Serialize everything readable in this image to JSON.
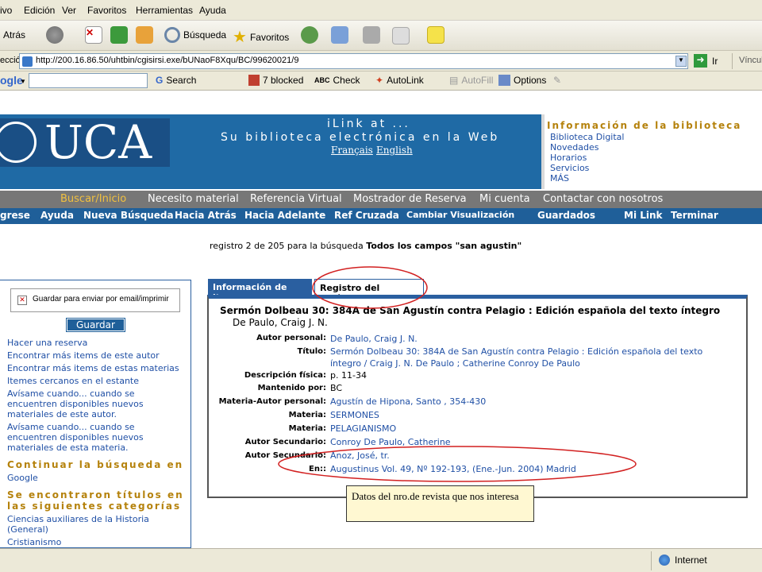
{
  "menubar": {
    "items": [
      "ivo",
      "Edición",
      "Ver",
      "Favoritos",
      "Herramientas",
      "Ayuda"
    ]
  },
  "toolbar": {
    "back": "Atrás",
    "search": "Búsqueda",
    "favorites": "Favoritos"
  },
  "address": {
    "label": "ección",
    "url": "http://200.16.86.50/uhtbin/cgisirsi.exe/bUNaoF8Xqu/BC/99620021/9",
    "go": "Ir",
    "links": "Víncul"
  },
  "googlebar": {
    "brand": "ogle",
    "search": "Search",
    "blocked": "7 blocked",
    "check": "Check",
    "autolink": "AutoLink",
    "autofill": "AutoFill",
    "options": "Options"
  },
  "banner": {
    "logo_text": "UCA",
    "line1": "iLink at ...",
    "line2": "Su biblioteca electrónica en la Web",
    "lang_fr": "Français",
    "lang_en": "English"
  },
  "info": {
    "title": "Información de la biblioteca",
    "links": [
      "Biblioteca Digital",
      "Novedades",
      "Horarios",
      "Servicios",
      "MÁS"
    ]
  },
  "nav1": [
    "Buscar/Inicio",
    "Necesito material",
    "Referencia Virtual",
    "Mostrador de Reserva",
    "Mi cuenta",
    "Contactar con nosotros"
  ],
  "nav2": [
    "grese",
    "Ayuda",
    "Nueva Búsqueda",
    "Hacia Atrás",
    "Hacia Adelante",
    "Ref Cruzada",
    "Cambiar Visualización",
    "Guardados",
    "Mi Link",
    "Terminar"
  ],
  "result_info": {
    "prefix": "registro 2 de 205 para la búsqueda",
    "query": "Todos los campos \"san agustin\""
  },
  "sidebar": {
    "checkbox_label": "Guardar para enviar por email/imprimir",
    "save_button": "Guardar par",
    "links": [
      "Hacer una reserva",
      "Encontrar más items de este autor",
      "Encontrar más items de estas materias",
      "Itemes cercanos en el estante",
      "Avísame cuando... cuando se encuentren disponibles nuevos materiales de este autor.",
      "Avísame cuando... cuando se encuentren disponibles nuevos materiales de esta materia."
    ],
    "continue_heading": "Continuar la búsqueda en",
    "google_link": "Google",
    "categories_heading": "Se encontraron títulos en las siguientes categorías",
    "category_links": [
      "Ciencias auxiliares de la Historia (General)",
      "Cristianismo"
    ]
  },
  "tabs": {
    "info_item": "Información de item",
    "catalog": "Registro del catálogo"
  },
  "record": {
    "title": "Sermón Dolbeau 30: 384A de San Agustín contra Pelagio : Edición española del texto íntegro",
    "author_line": "De Paulo, Craig J. N.",
    "fields": [
      {
        "label": "Autor personal:",
        "value": "De Paulo, Craig J. N."
      },
      {
        "label": "Título:",
        "value": "Sermón Dolbeau 30: 384A de San Agustín contra Pelagio : Edición española del texto íntegro / Craig J. N. De Paulo ; Catherine Conroy De Paulo"
      },
      {
        "label": "Descripción física:",
        "value": "p. 11-34"
      },
      {
        "label": "Mantenido por:",
        "value": "BC"
      },
      {
        "label": "Materia-Autor personal:",
        "value": "Agustín de Hipona, Santo , 354-430"
      },
      {
        "label": "Materia:",
        "value": "SERMONES"
      },
      {
        "label": "Materia:",
        "value": "PELAGIANISMO"
      },
      {
        "label": "Autor Secundario:",
        "value": "Conroy De Paulo, Catherine"
      },
      {
        "label": "Autor Secundario:",
        "value": "Anoz, José, tr."
      },
      {
        "label": "En::",
        "value": "Augustinus Vol. 49, Nº 192-193, (Ene.-Jun. 2004) Madrid"
      }
    ]
  },
  "callout": {
    "text": "Datos del nro.de revista que nos interesa"
  },
  "status": {
    "zone": "Internet"
  },
  "colors": {
    "banner": "#1f6aa5",
    "nav_gray": "#777777",
    "nav_blue": "#1f5f99",
    "gold": "#b5820c",
    "annotation_red": "#d22020"
  }
}
